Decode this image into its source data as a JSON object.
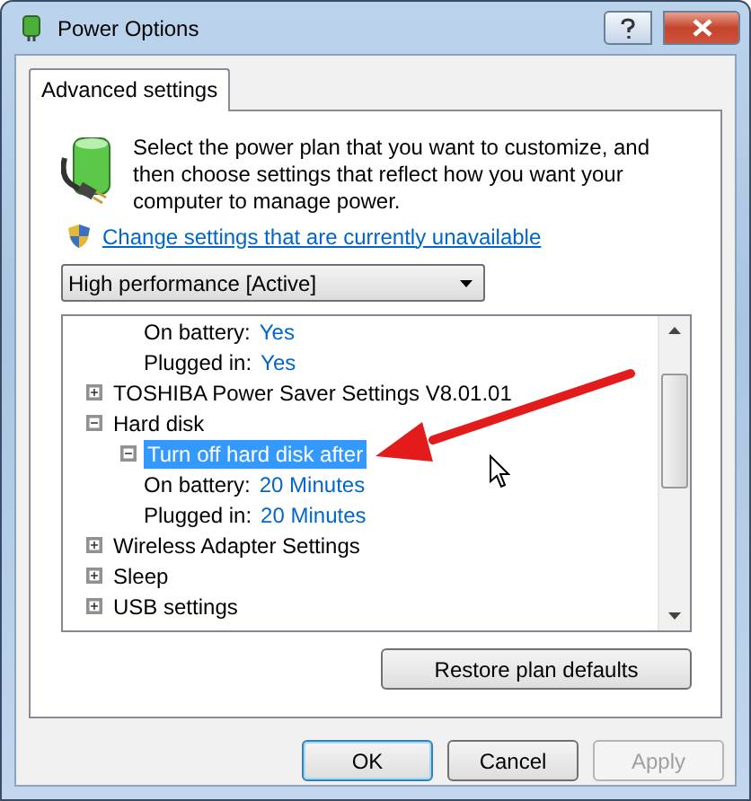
{
  "window": {
    "title": "Power Options"
  },
  "tabs": [
    {
      "label": "Advanced settings",
      "selected": true
    }
  ],
  "intro": "Select the power plan that you want to customize, and then choose settings that reflect how you want your computer to manage power.",
  "link": "Change settings that are currently unavailable",
  "plan_dropdown": {
    "value": "High performance [Active]"
  },
  "tree": [
    {
      "kind": "group",
      "children": [
        {
          "kind": "group",
          "children": [
            {
              "kind": "value",
              "label": "On battery:",
              "value": "Yes"
            },
            {
              "kind": "value",
              "label": "Plugged in:",
              "value": "Yes"
            }
          ]
        }
      ]
    },
    {
      "kind": "group",
      "label": "TOSHIBA Power Saver Settings V8.01.01",
      "expanded": false,
      "selected": false
    },
    {
      "kind": "group",
      "label": "Hard disk",
      "expanded": true,
      "selected": false,
      "children": [
        {
          "kind": "group",
          "label": "Turn off hard disk after",
          "expanded": true,
          "selected": true,
          "children": [
            {
              "kind": "value",
              "label": "On battery:",
              "value": "20 Minutes"
            },
            {
              "kind": "value",
              "label": "Plugged in:",
              "value": "20 Minutes"
            }
          ]
        }
      ]
    },
    {
      "kind": "group",
      "label": "Wireless Adapter Settings",
      "expanded": false,
      "selected": false
    },
    {
      "kind": "group",
      "label": "Sleep",
      "expanded": false,
      "selected": false
    },
    {
      "kind": "group",
      "label": "USB settings",
      "expanded": false,
      "selected": false
    }
  ],
  "restore_button": "Restore plan defaults",
  "buttons": [
    {
      "label": "OK",
      "disabled": false,
      "default": true
    },
    {
      "label": "Cancel",
      "disabled": false,
      "default": false
    },
    {
      "label": "Apply",
      "disabled": true,
      "default": false
    }
  ]
}
